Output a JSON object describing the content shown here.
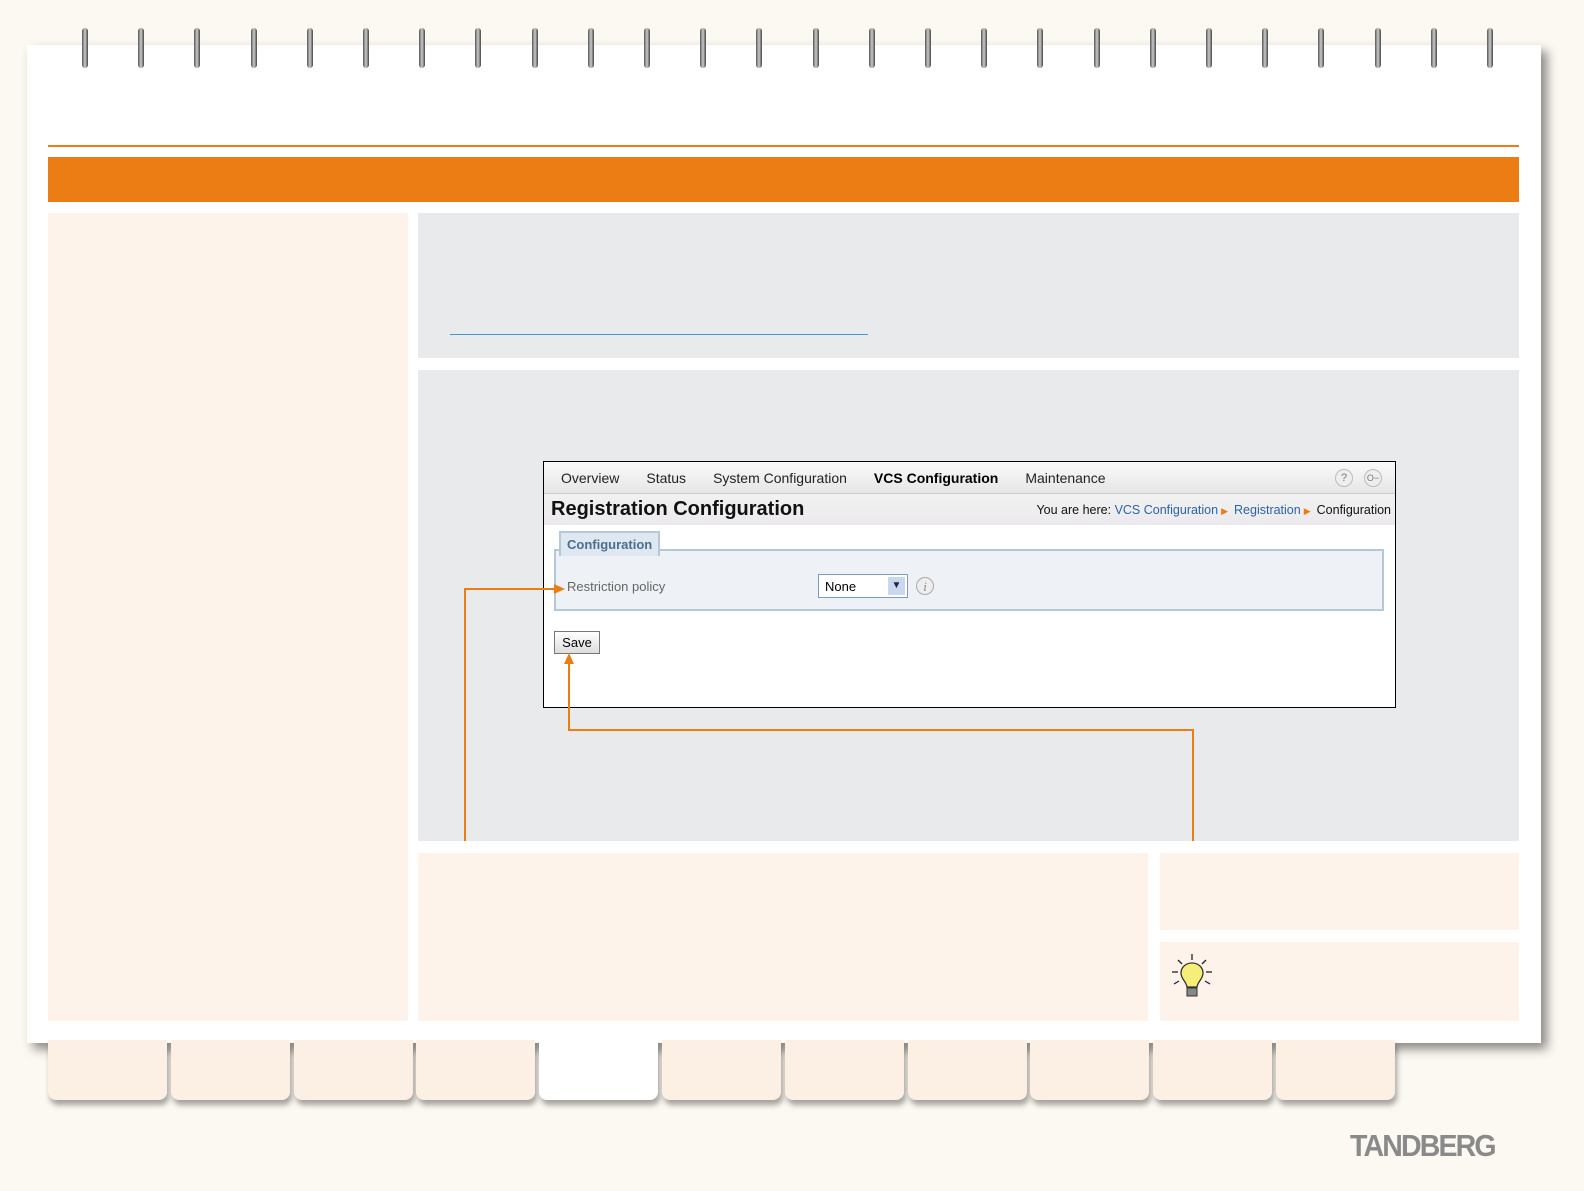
{
  "brand": "TANDBERG",
  "colors": {
    "accent": "#ec7d14",
    "panel": "#fdf3ea",
    "gray": "#e9eaec"
  },
  "screenshot": {
    "nav": [
      "Overview",
      "Status",
      "System Configuration",
      "VCS Configuration",
      "Maintenance"
    ],
    "active_nav": "VCS Configuration",
    "icons": [
      "help-icon",
      "logout-icon"
    ],
    "help_glyph": "?",
    "logout_glyph": "O−",
    "title": "Registration Configuration",
    "breadcrumb": {
      "prefix": "You are here:",
      "items": [
        "VCS Configuration",
        "Registration"
      ],
      "current": "Configuration"
    },
    "section": "Configuration",
    "field_label": "Restriction policy",
    "field_value": "None",
    "info_glyph": "i",
    "save_label": "Save"
  },
  "tabs_count": 11,
  "active_tab": 4
}
